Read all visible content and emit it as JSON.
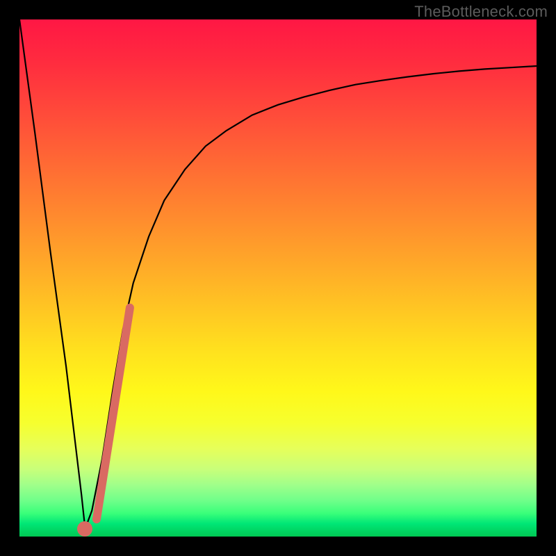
{
  "watermark": "TheBottleneck.com",
  "colors": {
    "frame": "#000000",
    "curve": "#000000",
    "spike": "#d96a62",
    "ball": "#d96a62"
  },
  "chart_data": {
    "type": "line",
    "title": "",
    "xlabel": "",
    "ylabel": "",
    "xlim": [
      0,
      100
    ],
    "ylim": [
      0,
      100
    ],
    "grid": false,
    "series": [
      {
        "name": "bottleneck-curve",
        "x": [
          0,
          3,
          6,
          9,
          12,
          12.7,
          14,
          16,
          18,
          20,
          22,
          25,
          28,
          32,
          36,
          40,
          45,
          50,
          55,
          60,
          65,
          70,
          75,
          80,
          85,
          90,
          95,
          100
        ],
        "values": [
          100,
          78,
          55,
          33,
          8,
          1.5,
          5,
          15,
          28,
          40,
          49,
          58,
          65,
          71,
          75.5,
          78.5,
          81.5,
          83.5,
          85,
          86.3,
          87.4,
          88.2,
          88.9,
          89.5,
          90,
          90.4,
          90.7,
          91
        ]
      }
    ],
    "annotations": {
      "marker_point": {
        "x": 12.7,
        "y": 1.5
      },
      "spike_segment": {
        "x_start": 14.8,
        "y_start": 2.5,
        "x_end": 21.5,
        "y_end": 45
      }
    }
  }
}
